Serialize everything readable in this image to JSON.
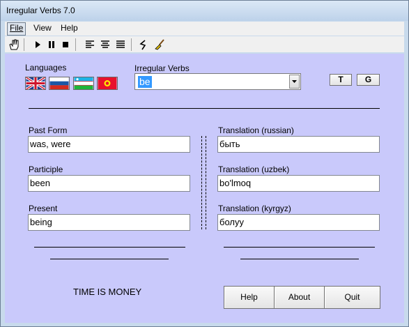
{
  "window": {
    "title": "Irregular Verbs 7.0"
  },
  "menu": [
    "File",
    "View",
    "Help"
  ],
  "toolbar": {
    "buttons": [
      "hand-icon",
      "play-icon",
      "pause-icon",
      "stop-icon",
      "align-left-icon",
      "align-center-icon",
      "align-justify-icon",
      "undo-icon",
      "brush-icon"
    ]
  },
  "languages": {
    "label": "Languages",
    "flags": [
      "uk-flag-icon",
      "russia-flag-icon",
      "uzbekistan-flag-icon",
      "kyrgyzstan-flag-icon"
    ]
  },
  "verbs": {
    "label": "Irregular Verbs",
    "selected": "be"
  },
  "toggles": {
    "t_label": "T",
    "g_label": "G"
  },
  "forms": {
    "past_label": "Past Form",
    "past_value": "was, were",
    "participle_label": "Participle",
    "participle_value": "been",
    "present_label": "Present",
    "present_value": "being"
  },
  "translations": {
    "russian_label": "Translation (russian)",
    "russian_value": "быть",
    "uzbek_label": "Translation (uzbek)",
    "uzbek_value": "bo'lmoq",
    "kyrgyz_label": "Translation (kyrgyz)",
    "kyrgyz_value": "болуу"
  },
  "footer": {
    "motto": "TIME IS MONEY",
    "help_label": "Help",
    "about_label": "About",
    "quit_label": "Quit"
  },
  "colors": {
    "client_bg": "#c9c9fb",
    "selection": "#3399ff"
  }
}
